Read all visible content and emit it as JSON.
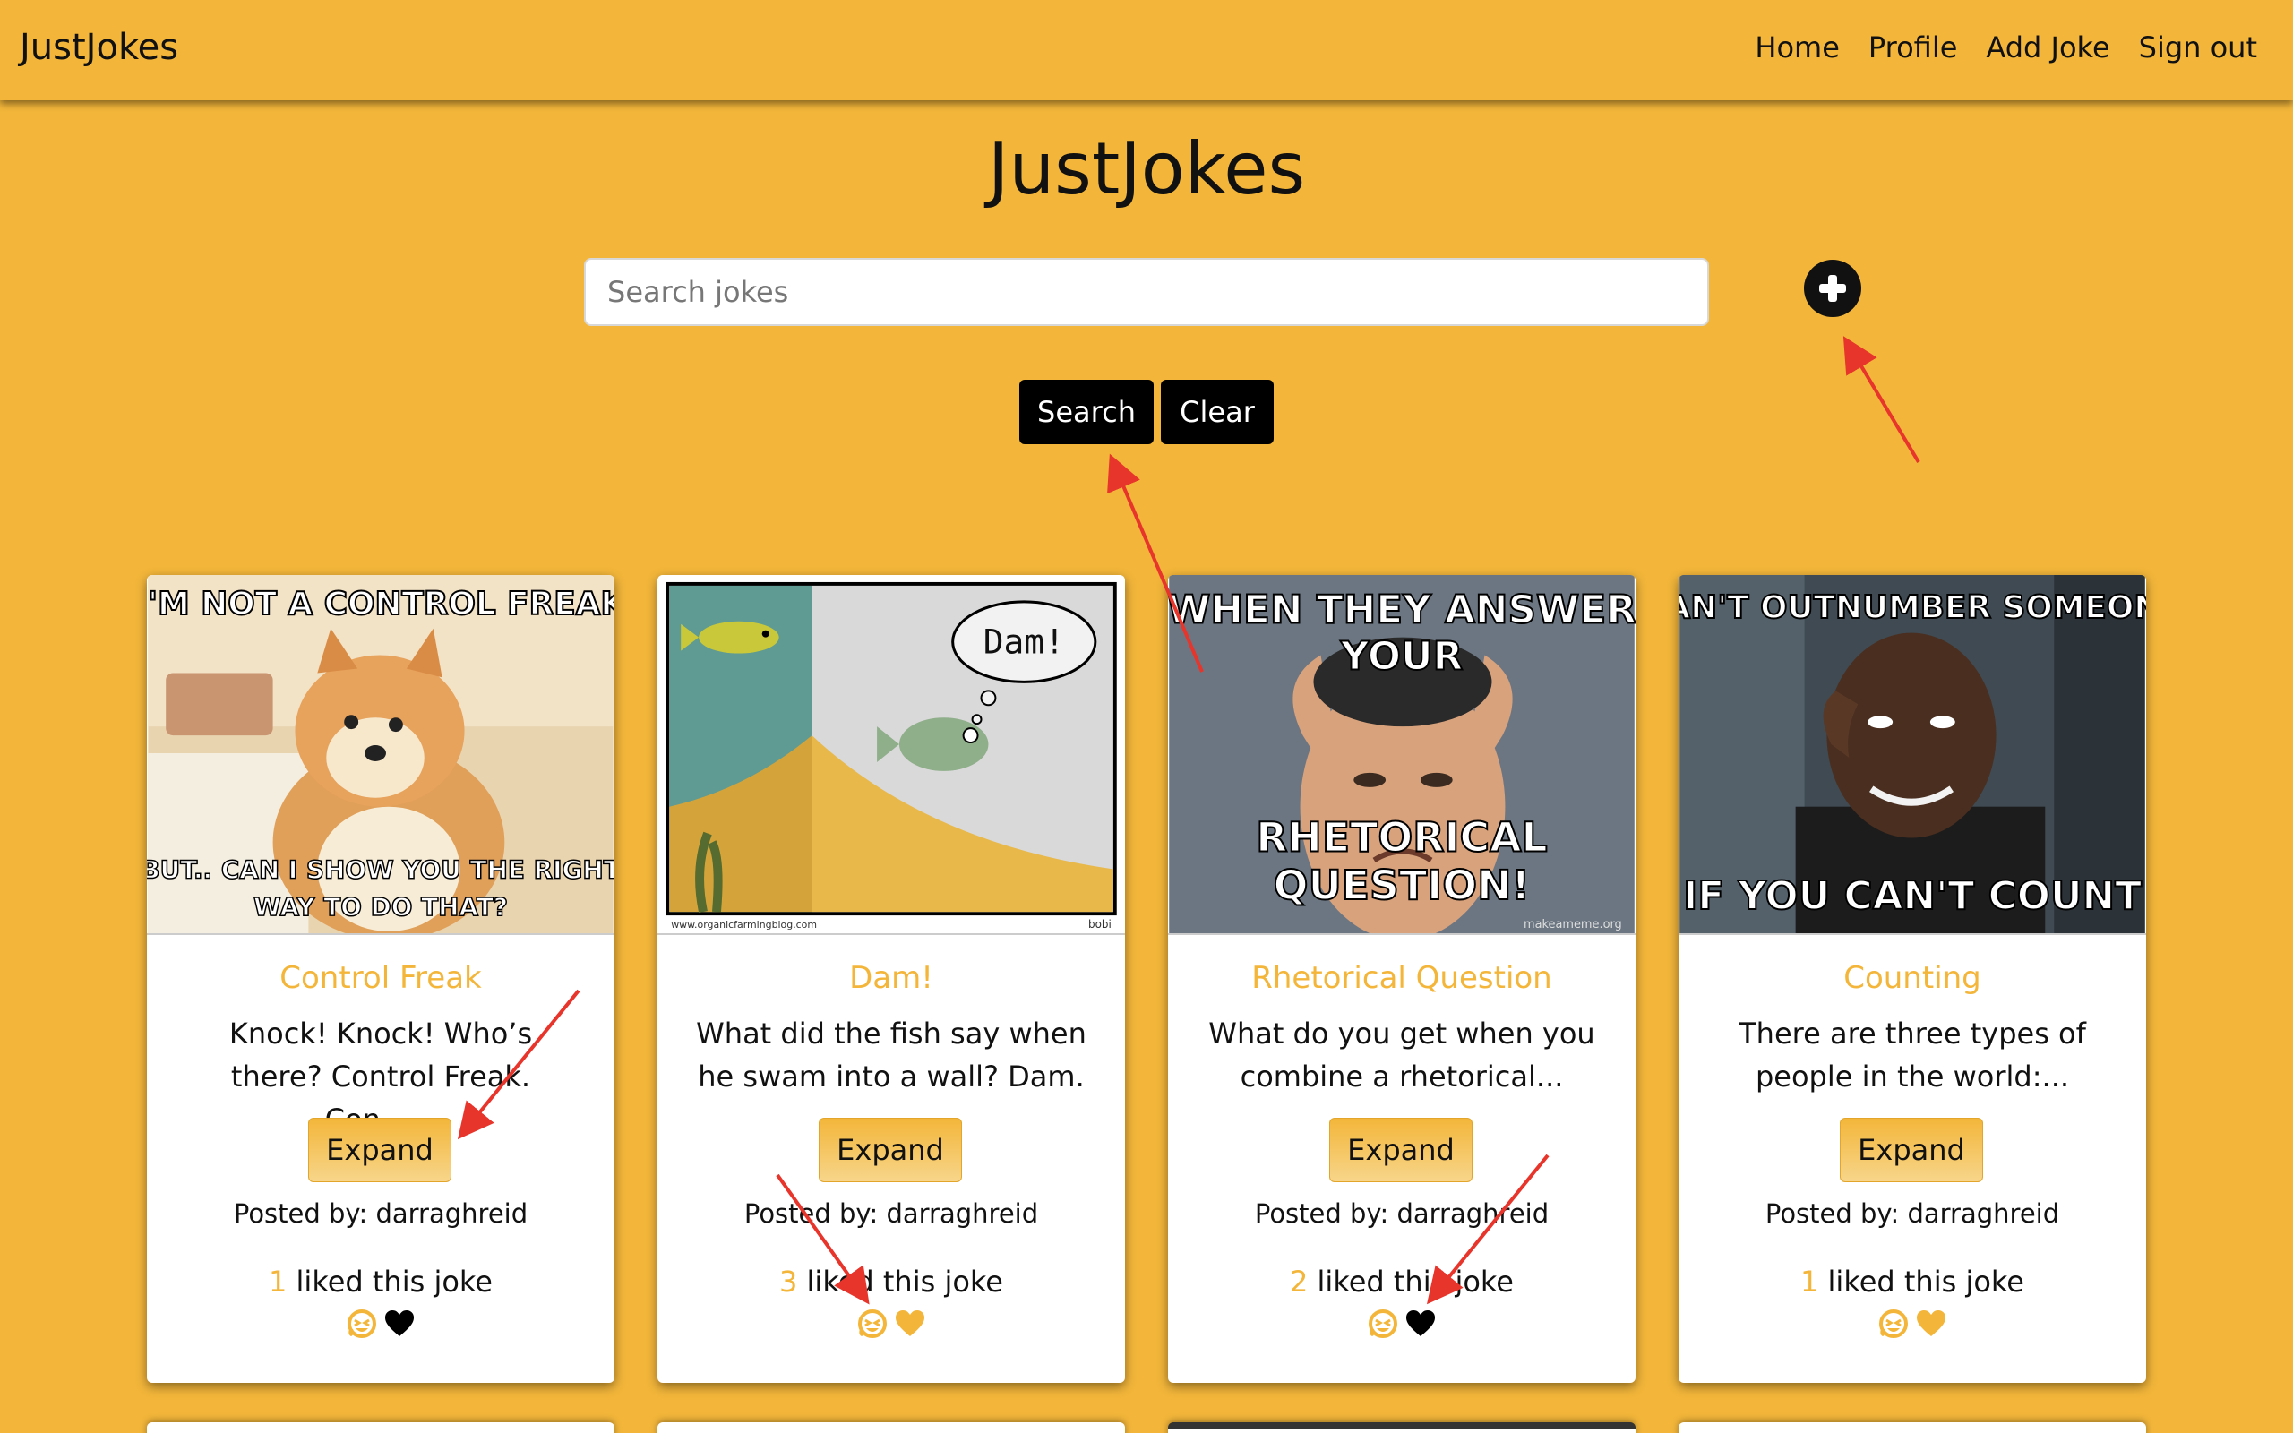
{
  "nav": {
    "brand": "JustJokes",
    "links": [
      "Home",
      "Profile",
      "Add Joke",
      "Sign out"
    ]
  },
  "header": {
    "title": "JustJokes",
    "search_placeholder": "Search jokes",
    "search_button": "Search",
    "clear_button": "Clear"
  },
  "cards": [
    {
      "title": "Control Freak",
      "text": "Knock! Knock! Who’s there? Control Freak. Con…...",
      "expand": "Expand",
      "posted_by": "Posted by: darraghreid",
      "like_count": "1",
      "likes_suffix": " liked this joke",
      "heart_color": "#000000",
      "image_text_top": "I'M NOT A CONTROL FREAK",
      "image_text_bottom_1": "BUT.. CAN I SHOW YOU THE RIGHT",
      "image_text_bottom_2": "WAY TO DO THAT?"
    },
    {
      "title": "Dam!",
      "text": "What did the fish say when he swam into a wall? Dam.",
      "expand": "Expand",
      "posted_by": "Posted by: darraghreid",
      "like_count": "3",
      "likes_suffix": " liked this joke",
      "heart_color": "#f3b63a",
      "image_bubble": "Dam!",
      "image_credit_left": "www.organicfarmingblog.com",
      "image_credit_right": "bobi"
    },
    {
      "title": "Rhetorical Question",
      "text": "What do you get when you combine a rhetorical...",
      "expand": "Expand",
      "posted_by": "Posted by: darraghreid",
      "like_count": "2",
      "likes_suffix": " liked this joke",
      "heart_color": "#000000",
      "image_text_top_1": "WHEN THEY ANSWER",
      "image_text_top_2": "YOUR",
      "image_text_bottom_1": "RHETORICAL",
      "image_text_bottom_2": "QUESTION!",
      "image_credit": "makeameme.org"
    },
    {
      "title": "Counting",
      "text": "There are three types of people in the world:...",
      "expand": "Expand",
      "posted_by": "Posted by: darraghreid",
      "like_count": "1",
      "likes_suffix": " liked this joke",
      "heart_color": "#f3b63a",
      "image_text_top": "CAN'T OUTNUMBER SOMEONE",
      "image_text_bottom": "IF YOU CAN'T COUNT"
    }
  ],
  "colors": {
    "accent": "#f3b63a",
    "annotation_arrow": "#e8352b"
  }
}
